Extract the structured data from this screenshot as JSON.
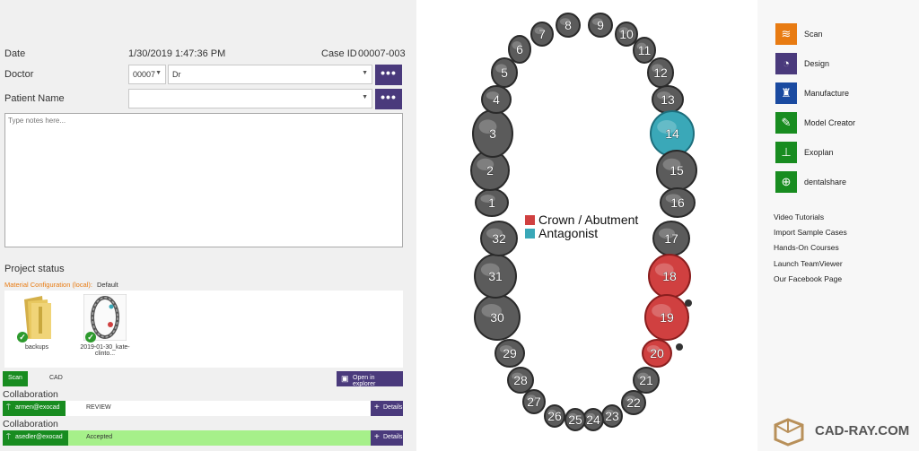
{
  "left": {
    "date_label": "Date",
    "date_value": "1/30/2019   1:47:36 PM",
    "case_id_label": "Case ID",
    "case_id_value": "00007-003",
    "doctor_label": "Doctor",
    "doctor_code": "00007",
    "doctor_name": "Dr",
    "patient_label": "Patient Name",
    "notes_placeholder": "Type notes here...",
    "project_status": "Project status",
    "material_config_label": "Material Configuration (local):",
    "material_config_value": "Default",
    "files": [
      {
        "name": "backups"
      },
      {
        "name": "2019-01-30_kate-clinto..."
      }
    ],
    "status_tag": "Scan",
    "status_text": "CAD",
    "open_explorer": "Open in explorer",
    "collab_title_1": "Collaboration",
    "collab_user_1": "armen@exocad",
    "collab_status_1": "REVIEW",
    "collab_title_2": "Collaboration",
    "collab_user_2": "asedler@exocad",
    "collab_status_2": "Accepted",
    "details_label": "Details",
    "dots": "•••"
  },
  "center": {
    "legend": [
      {
        "label": "Crown / Abutment",
        "color": "#d04040"
      },
      {
        "label": "Antagonist",
        "color": "#3aa8b8"
      }
    ],
    "teeth": [
      {
        "n": "1"
      },
      {
        "n": "2"
      },
      {
        "n": "3"
      },
      {
        "n": "4"
      },
      {
        "n": "5"
      },
      {
        "n": "6"
      },
      {
        "n": "7"
      },
      {
        "n": "8"
      },
      {
        "n": "9"
      },
      {
        "n": "10"
      },
      {
        "n": "11"
      },
      {
        "n": "12"
      },
      {
        "n": "13"
      },
      {
        "n": "14",
        "state": "antagonist"
      },
      {
        "n": "15"
      },
      {
        "n": "16"
      },
      {
        "n": "17"
      },
      {
        "n": "18",
        "state": "crown"
      },
      {
        "n": "19",
        "state": "crown"
      },
      {
        "n": "20",
        "state": "crown"
      },
      {
        "n": "21"
      },
      {
        "n": "22"
      },
      {
        "n": "23"
      },
      {
        "n": "24"
      },
      {
        "n": "25"
      },
      {
        "n": "26"
      },
      {
        "n": "27"
      },
      {
        "n": "28"
      },
      {
        "n": "29"
      },
      {
        "n": "30"
      },
      {
        "n": "31"
      },
      {
        "n": "32"
      }
    ]
  },
  "right": {
    "apps": [
      {
        "name": "Scan",
        "color": "#e87b12",
        "icon": "scan-icon"
      },
      {
        "name": "Design",
        "color": "#4a3a7c",
        "icon": "design-icon"
      },
      {
        "name": "Manufacture",
        "color": "#1a4aa0",
        "icon": "manufacture-icon"
      },
      {
        "name": "Model Creator",
        "color": "#188c20",
        "icon": "model-creator-icon"
      },
      {
        "name": "Exoplan",
        "color": "#188c20",
        "icon": "exoplan-icon"
      },
      {
        "name": "dentalshare",
        "color": "#188c20",
        "icon": "dentalshare-icon"
      }
    ],
    "links": [
      "Video Tutorials",
      "Import Sample Cases",
      "Hands-On Courses",
      "Launch TeamViewer",
      "Our Facebook Page"
    ],
    "watermark": "CAD-RAY.COM"
  }
}
